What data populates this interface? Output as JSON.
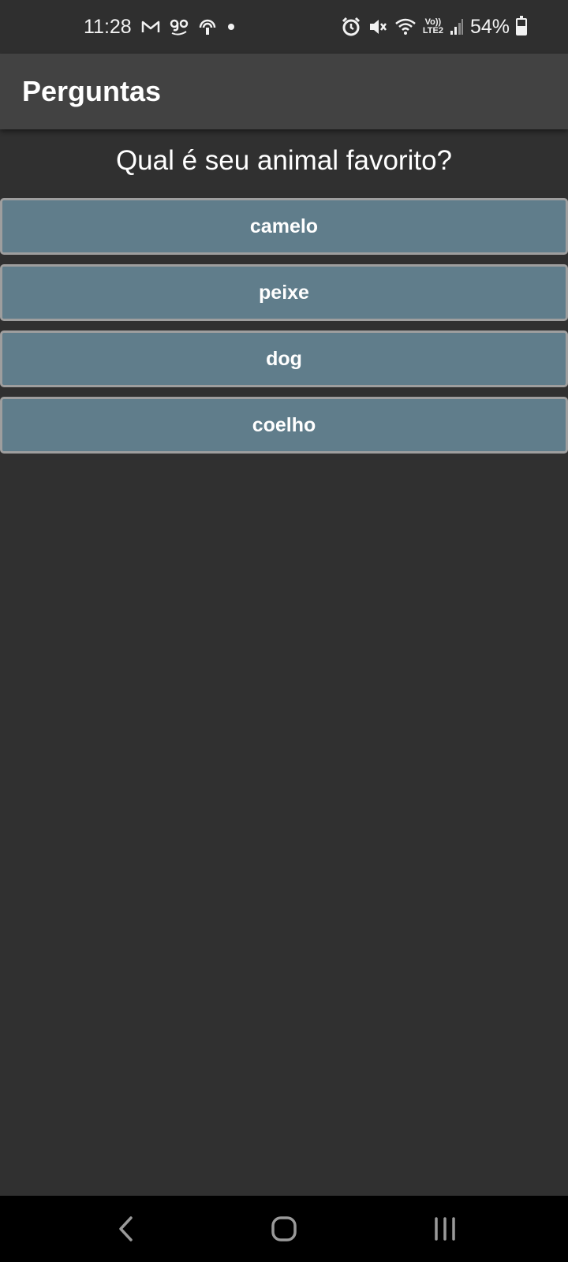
{
  "status_bar": {
    "time": "11:28",
    "left_icons": [
      "gmail-icon",
      "go-icon",
      "hotspot-icon",
      "dot-icon"
    ],
    "right_icons": [
      "alarm-icon",
      "mute-icon",
      "wifi-icon",
      "volte-icon",
      "signal-icon"
    ],
    "volte_label_top": "Vo))",
    "volte_label_bottom": "LTE2",
    "battery": "54%",
    "battery_level": 0.54
  },
  "app_bar": {
    "title": "Perguntas"
  },
  "question": "Qual é seu animal favorito?",
  "answers": [
    {
      "label": "camelo"
    },
    {
      "label": "peixe"
    },
    {
      "label": "dog"
    },
    {
      "label": "coelho"
    }
  ],
  "colors": {
    "background": "#303030",
    "app_bar": "#424242",
    "button": "#607d8b",
    "button_border": "#9e9e9e",
    "nav_bar": "#000000"
  },
  "nav_bar": {
    "buttons": [
      "back-icon",
      "home-icon",
      "recents-icon"
    ]
  }
}
